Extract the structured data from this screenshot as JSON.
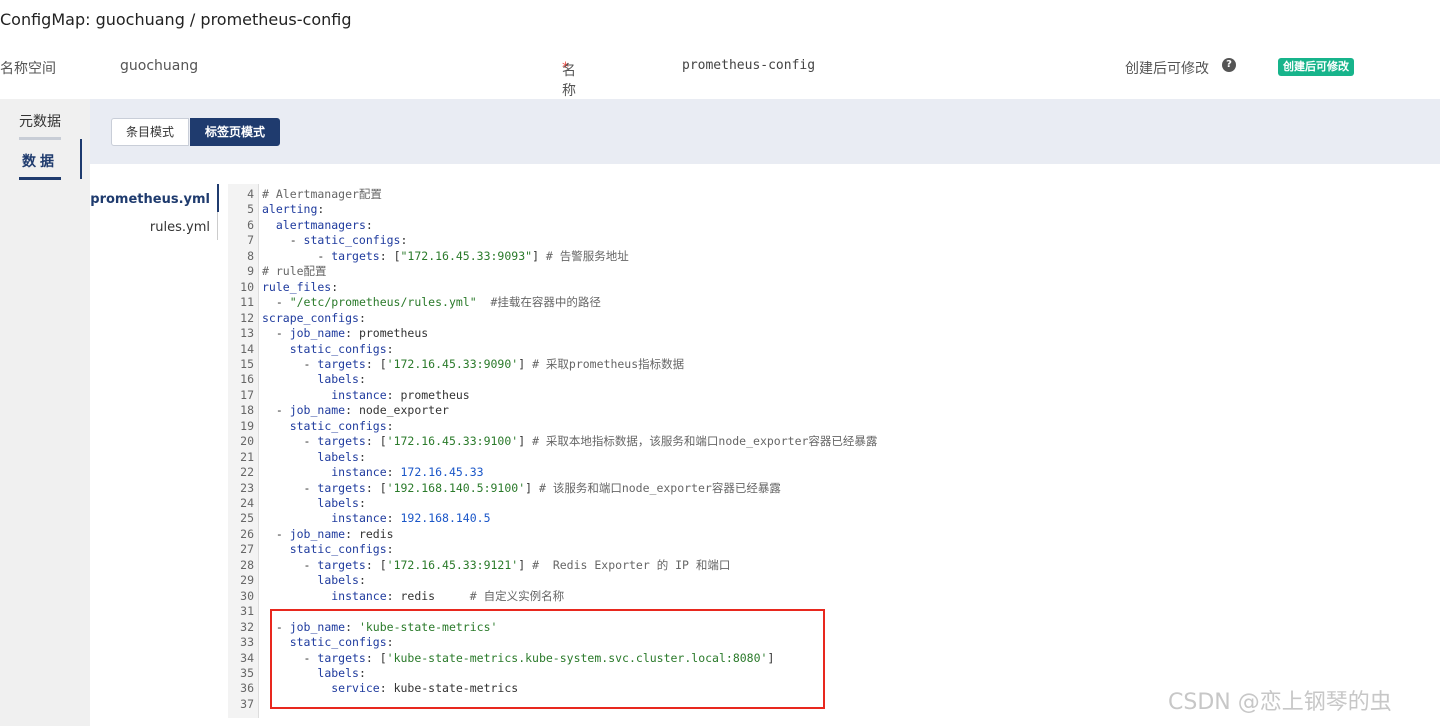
{
  "page": {
    "title": "ConfigMap: guochuang / prometheus-config"
  },
  "meta": {
    "namespace_label": "名称空间",
    "namespace_value": "guochuang",
    "name_required": "*",
    "name_label": "名称",
    "name_value": "prometheus-config",
    "editable_label": "创建后可修改",
    "help_icon": "?",
    "editable_badge": "创建后可修改"
  },
  "leftnav": {
    "metadata": "元数据",
    "data": "数据"
  },
  "modes": {
    "list": "条目模式",
    "tab": "标签页模式",
    "active": "tab"
  },
  "files": {
    "items": [
      "prometheus.yml",
      "rules.yml"
    ],
    "active": "prometheus.yml"
  },
  "code": [
    {
      "n": "4",
      "text": "# Alertmanager配置"
    },
    {
      "n": "5",
      "text": "alerting:"
    },
    {
      "n": "6",
      "text": "  alertmanagers:"
    },
    {
      "n": "7",
      "text": "    - static_configs:"
    },
    {
      "n": "8",
      "text": "        - targets: [\"172.16.45.33:9093\"] # 告警服务地址"
    },
    {
      "n": "9",
      "text": "# rule配置"
    },
    {
      "n": "10",
      "text": "rule_files:"
    },
    {
      "n": "11",
      "text": "  - \"/etc/prometheus/rules.yml\"  #挂载在容器中的路径"
    },
    {
      "n": "12",
      "text": "scrape_configs:"
    },
    {
      "n": "13",
      "text": "  - job_name: prometheus"
    },
    {
      "n": "14",
      "text": "    static_configs:"
    },
    {
      "n": "15",
      "text": "      - targets: ['172.16.45.33:9090'] # 采取prometheus指标数据"
    },
    {
      "n": "16",
      "text": "        labels:"
    },
    {
      "n": "17",
      "text": "          instance: prometheus"
    },
    {
      "n": "18",
      "text": "  - job_name: node_exporter"
    },
    {
      "n": "19",
      "text": "    static_configs:"
    },
    {
      "n": "20",
      "text": "      - targets: ['172.16.45.33:9100'] # 采取本地指标数据，该服务和端口node_exporter容器已经暴露"
    },
    {
      "n": "21",
      "text": "        labels:"
    },
    {
      "n": "22",
      "text": "          instance: 172.16.45.33"
    },
    {
      "n": "23",
      "text": "      - targets: ['192.168.140.5:9100'] # 该服务和端口node_exporter容器已经暴露"
    },
    {
      "n": "24",
      "text": "        labels:"
    },
    {
      "n": "25",
      "text": "          instance: 192.168.140.5"
    },
    {
      "n": "26",
      "text": "  - job_name: redis"
    },
    {
      "n": "27",
      "text": "    static_configs:"
    },
    {
      "n": "28",
      "text": "      - targets: ['172.16.45.33:9121'] #  Redis Exporter 的 IP 和端口"
    },
    {
      "n": "29",
      "text": "        labels:"
    },
    {
      "n": "30",
      "text": "          instance: redis     # 自定义实例名称"
    },
    {
      "n": "31",
      "text": ""
    },
    {
      "n": "32",
      "text": "  - job_name: 'kube-state-metrics'"
    },
    {
      "n": "33",
      "text": "    static_configs:"
    },
    {
      "n": "34",
      "text": "      - targets: ['kube-state-metrics.kube-system.svc.cluster.local:8080']"
    },
    {
      "n": "35",
      "text": "        labels:"
    },
    {
      "n": "36",
      "text": "          service: kube-state-metrics"
    },
    {
      "n": "37",
      "text": ""
    }
  ],
  "watermark": "CSDN @恋上钢琴的虫",
  "colors": {
    "primary": "#1f3b6e",
    "badge": "#17b48b",
    "highlight": "#e8281e"
  }
}
